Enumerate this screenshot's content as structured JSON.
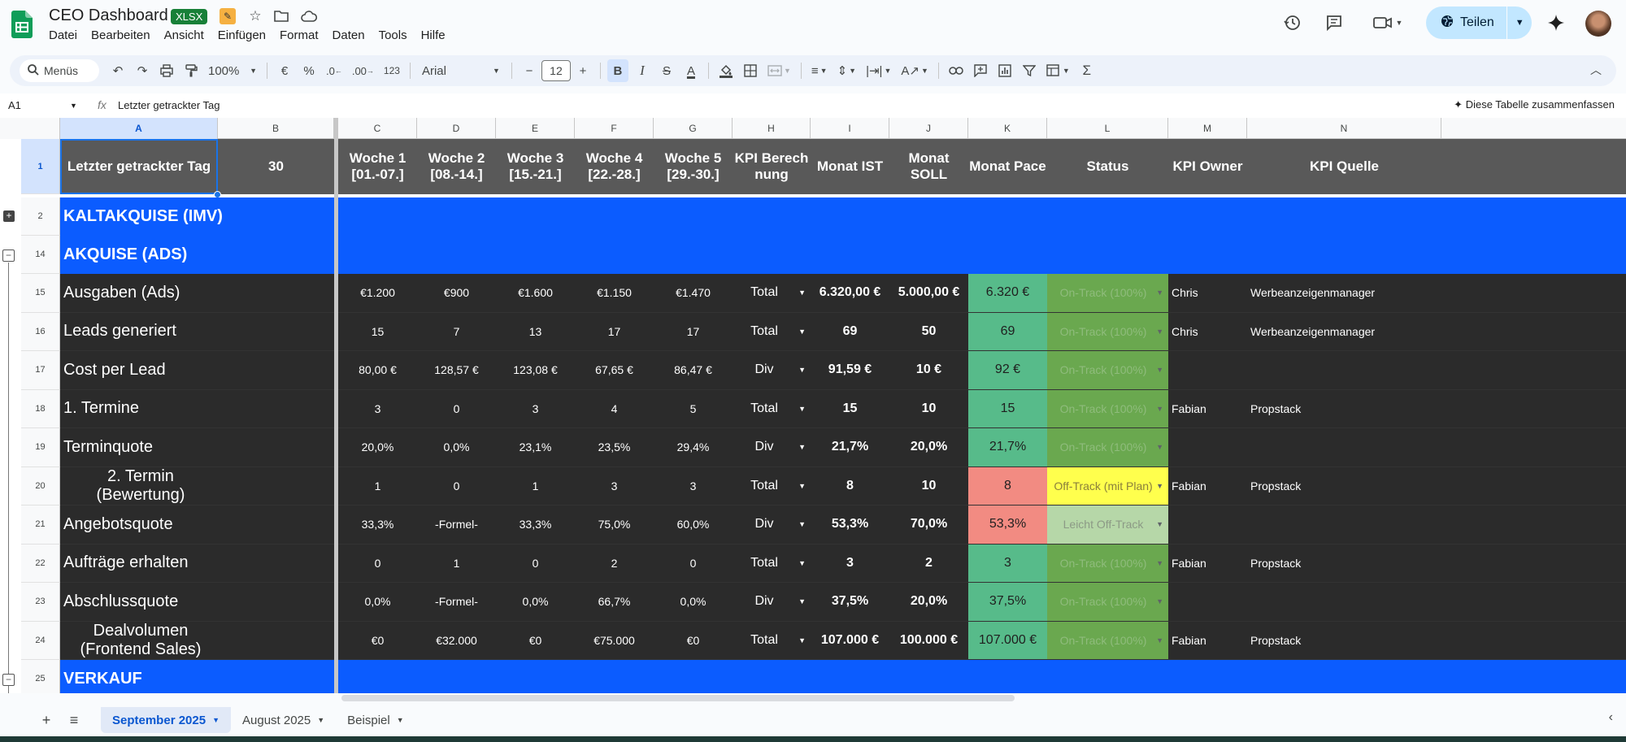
{
  "app": {
    "title": "CEO Dashboard",
    "badge": "XLSX",
    "menu": [
      "Datei",
      "Bearbeiten",
      "Ansicht",
      "Einfügen",
      "Format",
      "Daten",
      "Tools",
      "Hilfe"
    ],
    "share_label": "Teilen"
  },
  "toolbar": {
    "search_label": "Menüs",
    "zoom": "100%",
    "currency": "€",
    "percent": "%",
    "decimal_less": ".0",
    "decimal_more": ".00",
    "number_format": "123",
    "font": "Arial",
    "font_size": "12"
  },
  "formula_bar": {
    "cell_ref": "A1",
    "fx": "fx",
    "content": "Letzter getrackter Tag",
    "summarize_label": "Diese Tabelle zusammenfassen"
  },
  "columns": [
    "A",
    "B",
    "C",
    "D",
    "E",
    "F",
    "G",
    "H",
    "I",
    "J",
    "K",
    "L",
    "M",
    "N"
  ],
  "header": {
    "a": "Letzter getrackter Tag",
    "b": "30",
    "c": "Woche 1 [01.-07.]",
    "d": "Woche 2 [08.-14.]",
    "e": "Woche 3 [15.-21.]",
    "f": "Woche 4 [22.-28.]",
    "g": "Woche 5 [29.-30.]",
    "h": "KPI Berechnung",
    "i": "Monat IST",
    "j": "Monat SOLL",
    "k": "Monat Pace",
    "l": "Status",
    "m": "KPI Owner",
    "n": "KPI Quelle"
  },
  "row_numbers": [
    "1",
    "2",
    "14",
    "15",
    "16",
    "17",
    "18",
    "19",
    "20",
    "21",
    "22",
    "23",
    "24",
    "25"
  ],
  "sections": {
    "kaltakquise": "KALTAKQUISE (IMV)",
    "akquise": "AKQUISE (ADS)",
    "verkauf": "VERKAUF"
  },
  "kpi_rows": [
    {
      "row": "15",
      "label": "Ausgaben (Ads)",
      "w1": "€1.200",
      "w2": "€900",
      "w3": "€1.600",
      "w4": "€1.150",
      "w5": "€1.470",
      "calc": "Total",
      "ist": "6.320,00 €",
      "soll": "5.000,00 €",
      "pace": "6.320 €",
      "status": "On-Track (100%)",
      "owner": "Chris",
      "source": "Werbeanzeigenmanager"
    },
    {
      "row": "16",
      "label": "Leads generiert",
      "w1": "15",
      "w2": "7",
      "w3": "13",
      "w4": "17",
      "w5": "17",
      "calc": "Total",
      "ist": "69",
      "soll": "50",
      "pace": "69",
      "status": "On-Track (100%)",
      "owner": "Chris",
      "source": "Werbeanzeigenmanager"
    },
    {
      "row": "17",
      "label": "Cost per Lead",
      "w1": "80,00 €",
      "w2": "128,57 €",
      "w3": "123,08 €",
      "w4": "67,65 €",
      "w5": "86,47 €",
      "calc": "Div",
      "ist": "91,59 €",
      "soll": "10 €",
      "pace": "92 €",
      "status": "On-Track (100%)",
      "owner": "",
      "source": ""
    },
    {
      "row": "18",
      "label": "1. Termine",
      "w1": "3",
      "w2": "0",
      "w3": "3",
      "w4": "4",
      "w5": "5",
      "calc": "Total",
      "ist": "15",
      "soll": "10",
      "pace": "15",
      "status": "On-Track (100%)",
      "owner": "Fabian",
      "source": "Propstack"
    },
    {
      "row": "19",
      "label": "Terminquote",
      "w1": "20,0%",
      "w2": "0,0%",
      "w3": "23,1%",
      "w4": "23,5%",
      "w5": "29,4%",
      "calc": "Div",
      "ist": "21,7%",
      "soll": "20,0%",
      "pace": "21,7%",
      "status": "On-Track (100%)",
      "owner": "",
      "source": ""
    },
    {
      "row": "20",
      "label": "2. Termin (Bewertung)",
      "w1": "1",
      "w2": "0",
      "w3": "1",
      "w4": "3",
      "w5": "3",
      "calc": "Total",
      "ist": "8",
      "soll": "10",
      "pace": "8",
      "status": "Off-Track (mit Plan)",
      "owner": "Fabian",
      "source": "Propstack"
    },
    {
      "row": "21",
      "label": "Angebotsquote",
      "w1": "33,3%",
      "w2": "-Formel-",
      "w3": "33,3%",
      "w4": "75,0%",
      "w5": "60,0%",
      "calc": "Div",
      "ist": "53,3%",
      "soll": "70,0%",
      "pace": "53,3%",
      "status": "Leicht Off-Track",
      "owner": "",
      "source": ""
    },
    {
      "row": "22",
      "label": "Aufträge erhalten",
      "w1": "0",
      "w2": "1",
      "w3": "0",
      "w4": "2",
      "w5": "0",
      "calc": "Total",
      "ist": "3",
      "soll": "2",
      "pace": "3",
      "status": "On-Track (100%)",
      "owner": "Fabian",
      "source": "Propstack"
    },
    {
      "row": "23",
      "label": "Abschlussquote",
      "w1": "0,0%",
      "w2": "-Formel-",
      "w3": "0,0%",
      "w4": "66,7%",
      "w5": "0,0%",
      "calc": "Div",
      "ist": "37,5%",
      "soll": "20,0%",
      "pace": "37,5%",
      "status": "On-Track (100%)",
      "owner": "",
      "source": ""
    },
    {
      "row": "24",
      "label": "Dealvolumen (Frontend Sales)",
      "w1": "€0",
      "w2": "€32.000",
      "w3": "€0",
      "w4": "€75.000",
      "w5": "€0",
      "calc": "Total",
      "ist": "107.000 €",
      "soll": "100.000 €",
      "pace": "107.000 €",
      "status": "On-Track (100%)",
      "owner": "Fabian",
      "source": "Propstack"
    }
  ],
  "status_colors": {
    "On-Track (100%)": {
      "bg": "#6aa84f",
      "fg": "#8fbc7c"
    },
    "Off-Track (mit Plan)": {
      "bg": "#ffff4d",
      "fg": "#8a7f3c"
    },
    "Leicht Off-Track": {
      "bg": "#b6d7a8",
      "fg": "#8c9a86"
    }
  },
  "pace_colors": {
    "good": "#57bb8a",
    "bad": "#f28b82"
  },
  "pace_status": [
    "good",
    "good",
    "good",
    "good",
    "good",
    "bad",
    "bad",
    "good",
    "good",
    "good"
  ],
  "colors": {
    "section_blue": "#0b5cff",
    "dark_cell": "#2b2b2b",
    "header_gray": "#595959"
  },
  "sheet_tabs": [
    {
      "label": "September 2025",
      "active": true
    },
    {
      "label": "August 2025",
      "active": false
    },
    {
      "label": "Beispiel",
      "active": false
    }
  ],
  "icons": [
    "sheets-logo-icon",
    "history-icon",
    "comment-icon",
    "video-call-icon",
    "globe-icon",
    "gemini-spark-icon"
  ]
}
